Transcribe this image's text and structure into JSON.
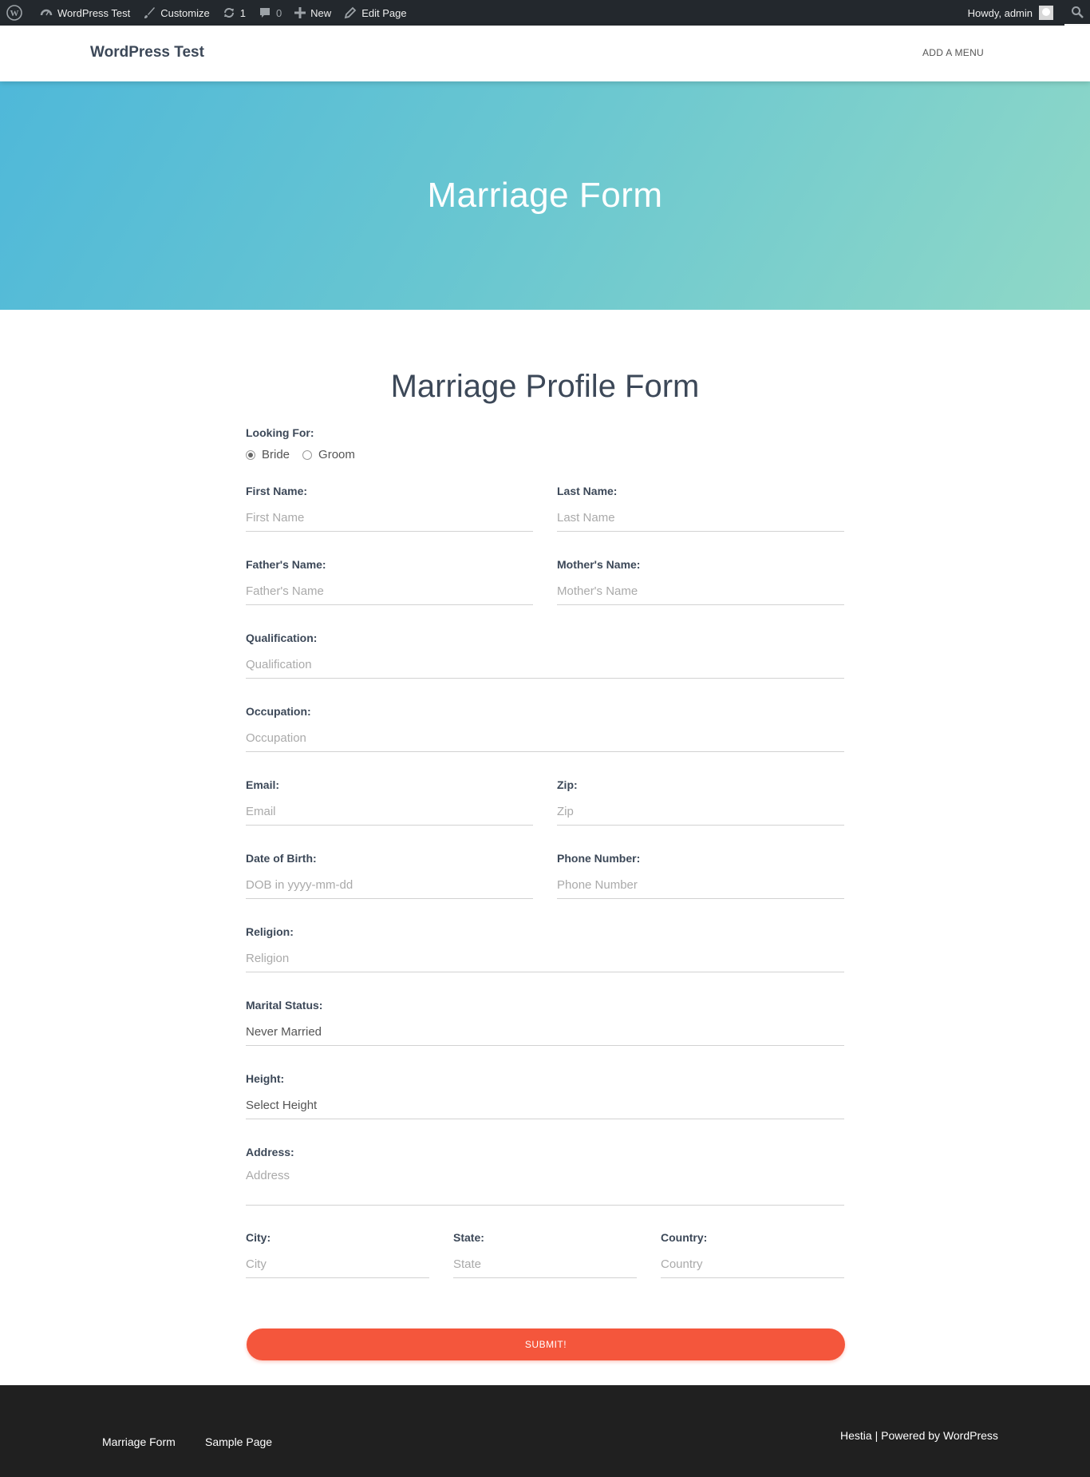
{
  "adminbar": {
    "site_name": "WordPress Test",
    "customize": "Customize",
    "updates_count": "1",
    "comments_count": "0",
    "new_label": "New",
    "edit_page": "Edit Page",
    "howdy": "Howdy, admin"
  },
  "header": {
    "site_title": "WordPress Test",
    "menu_link": "ADD A MENU"
  },
  "hero": {
    "title": "Marriage Form"
  },
  "form": {
    "title": "Marriage Profile Form",
    "looking_for": {
      "label": "Looking For:",
      "options": [
        "Bride",
        "Groom"
      ],
      "selected": "Bride"
    },
    "first_name": {
      "label": "First Name:",
      "placeholder": "First Name"
    },
    "last_name": {
      "label": "Last Name:",
      "placeholder": "Last Name"
    },
    "fathers_name": {
      "label": "Father's Name:",
      "placeholder": "Father's Name"
    },
    "mothers_name": {
      "label": "Mother's Name:",
      "placeholder": "Mother's Name"
    },
    "qualification": {
      "label": "Qualification:",
      "placeholder": "Qualification"
    },
    "occupation": {
      "label": "Occupation:",
      "placeholder": "Occupation"
    },
    "email": {
      "label": "Email:",
      "placeholder": "Email"
    },
    "zip": {
      "label": "Zip:",
      "placeholder": "Zip"
    },
    "dob": {
      "label": "Date of Birth:",
      "placeholder": "DOB in yyyy-mm-dd"
    },
    "phone": {
      "label": "Phone Number:",
      "placeholder": "Phone Number"
    },
    "religion": {
      "label": "Religion:",
      "placeholder": "Religion"
    },
    "marital_status": {
      "label": "Marital Status:",
      "value": "Never Married"
    },
    "height": {
      "label": "Height:",
      "value": "Select Height"
    },
    "address": {
      "label": "Address:",
      "placeholder": "Address"
    },
    "city": {
      "label": "City:",
      "placeholder": "City"
    },
    "state": {
      "label": "State:",
      "placeholder": "State"
    },
    "country": {
      "label": "Country:",
      "placeholder": "Country"
    },
    "submit": "SUBMIT!"
  },
  "footer": {
    "links": [
      "Marriage Form",
      "Sample Page"
    ],
    "credit_theme": "Hestia",
    "credit_sep": " | Powered by ",
    "credit_wp": "WordPress"
  },
  "colors": {
    "adminbar_bg": "#23282d",
    "hero_gradient_start": "#4fb8d9",
    "hero_gradient_end": "#8fd8c7",
    "submit_bg": "#f4563c",
    "footer_bg": "#202020"
  }
}
